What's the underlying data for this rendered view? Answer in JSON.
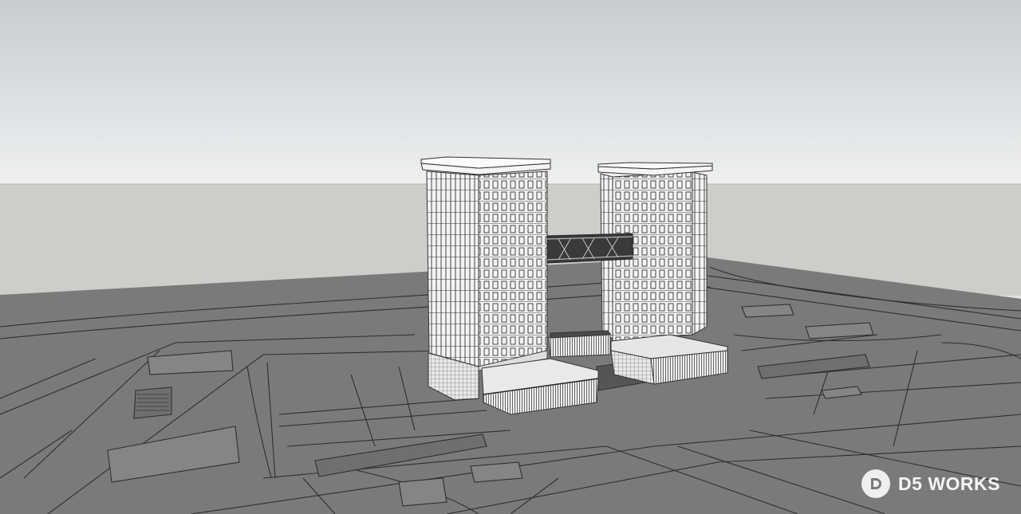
{
  "viewport": {
    "sky_top_color": "#c9ccd0",
    "sky_bottom_color": "#eef0f1",
    "ground_far_color": "#cdcdc9",
    "ground_plane_color": "#7a7a7a",
    "line_color": "#2e2e2e",
    "facade_color": "#f4f4f4",
    "bridge_color": "#3a3a3a"
  },
  "watermark": {
    "text": "D5 WORKS",
    "icon": "d5-logo-icon"
  }
}
